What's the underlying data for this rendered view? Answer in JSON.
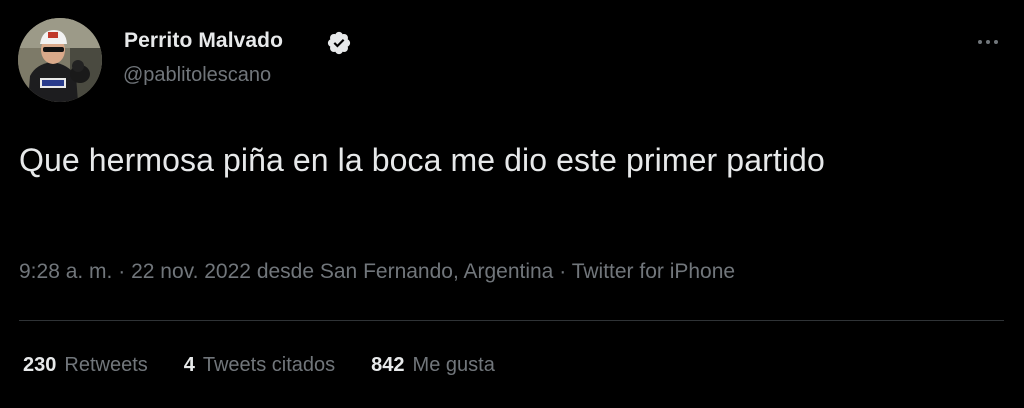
{
  "author": {
    "display_name": "Perrito Malvado",
    "handle": "@pablitolescano",
    "verified": true
  },
  "icons": {
    "avatar": "profile-photo",
    "verified": "verified-badge-icon",
    "more": "more-options-icon"
  },
  "tweet": {
    "text": "Que hermosa piña en la boca me dio este primer partido",
    "time": "9:28 a. m.",
    "date": "22 nov. 2022",
    "location": "desde San Fernando, Argentina",
    "source": "Twitter for iPhone",
    "sep": "·"
  },
  "stats": [
    {
      "count": "230",
      "label": "Retweets"
    },
    {
      "count": "4",
      "label": "Tweets citados"
    },
    {
      "count": "842",
      "label": "Me gusta"
    }
  ],
  "colors": {
    "background": "#000000",
    "text": "#e7e9ea",
    "secondary": "#71767b",
    "divider": "#2f3336",
    "verified_badge": "#e7e9ea"
  }
}
